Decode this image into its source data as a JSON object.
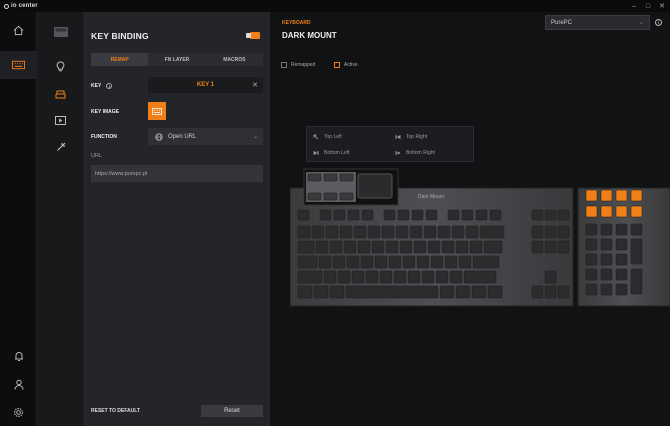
{
  "app": {
    "brand": "io center"
  },
  "panel": {
    "title": "KEY BINDING",
    "tabs": [
      {
        "label": "REMAP",
        "active": true
      },
      {
        "label": "FN LAYER",
        "active": false
      },
      {
        "label": "MACROS",
        "active": false
      }
    ],
    "key_label": "KEY",
    "key_value": "KEY 1",
    "key_image_label": "KEY IMAGE",
    "function_label": "FUNCTION",
    "function_value": "Open URL",
    "url_label": "URL",
    "url_value": "https://www.purepc.pl",
    "reset_default_label": "RESET TO DEFAULT",
    "reset_button": "Reset"
  },
  "main": {
    "category": "KEYBOARD",
    "name": "DARK MOUNT",
    "profile": "PurePC",
    "legend": {
      "remapped": "Remapped",
      "active": "Active"
    },
    "popup": {
      "top_left": "Top Left",
      "top_right": "Top Right",
      "bottom_left": "Bottom Left",
      "bottom_right": "Bottom Right"
    },
    "keyboard_brand": "Dark Mount"
  },
  "colors": {
    "accent": "#f07f19",
    "bg": "#111214",
    "panel": "#242528"
  }
}
